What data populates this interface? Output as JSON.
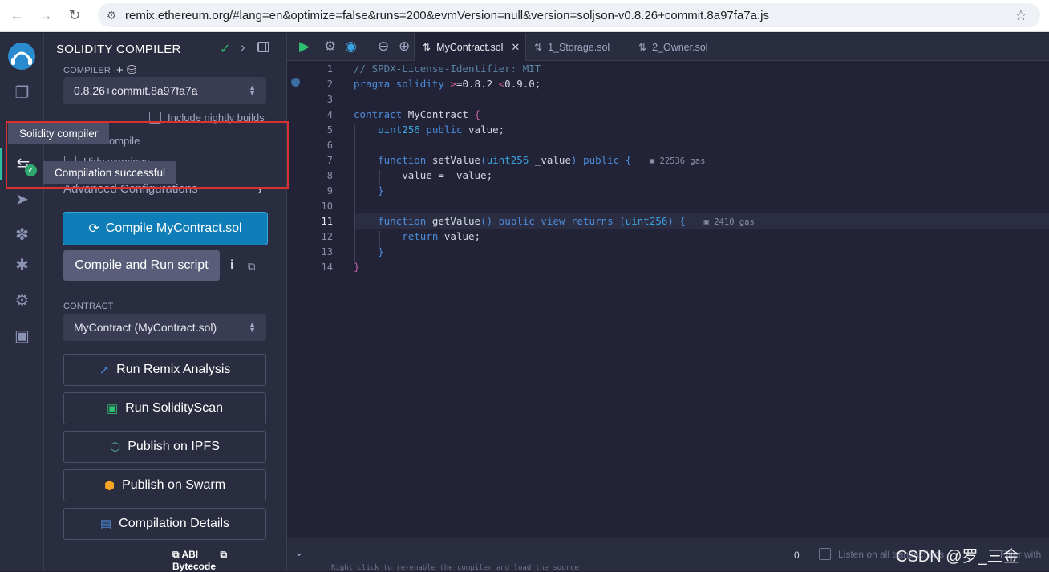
{
  "browser": {
    "url": "remix.ethereum.org/#lang=en&optimize=false&runs=200&evmVersion=null&version=soljson-v0.8.26+commit.8a97fa7a.js"
  },
  "panel": {
    "title": "SOLIDITY COMPILER",
    "compiler_label": "COMPILER",
    "compiler_version": "0.8.26+commit.8a97fa7a",
    "include_nightly": "Include nightly builds",
    "auto_compile": "ompile",
    "hide_warnings": "Hide warnings",
    "advanced": "Advanced Configurations",
    "compile_button": "Compile MyContract.sol",
    "compile_run_button": "Compile and Run script",
    "info": "i",
    "contract_label": "CONTRACT",
    "contract_value": "MyContract (MyContract.sol)",
    "run_analysis": "Run Remix Analysis",
    "run_solidityscan": "Run SolidityScan",
    "publish_ipfs": "Publish on IPFS",
    "publish_swarm": "Publish on Swarm",
    "compilation_details": "Compilation Details",
    "abi": "ABI",
    "bytecode": "Bytecode"
  },
  "tooltips": {
    "solidity_compiler": "Solidity compiler",
    "compilation_successful": "Compilation successful"
  },
  "editor": {
    "tabs": [
      {
        "label": "MyContract.sol",
        "active": true
      },
      {
        "label": "1_Storage.sol",
        "active": false
      },
      {
        "label": "2_Owner.sol",
        "active": false
      }
    ],
    "line_numbers": [
      "1",
      "2",
      "3",
      "4",
      "5",
      "6",
      "7",
      "8",
      "9",
      "10",
      "11",
      "12",
      "13",
      "14"
    ],
    "current_line": 11,
    "gas_set": "22536 gas",
    "gas_get": "2410 gas"
  },
  "terminal": {
    "count": "0",
    "listen_label": "Listen on all transactions",
    "filter_placeholder": "Filter with",
    "ghost_text": "Right click to re-enable the compiler and load the source"
  },
  "watermark": "CSDN @罗_三金",
  "colors": {
    "accent": "#0f7db7",
    "success": "#2fbf71",
    "highlight": "#d93030",
    "bg": "#222336",
    "panel": "#2a2c3f"
  }
}
